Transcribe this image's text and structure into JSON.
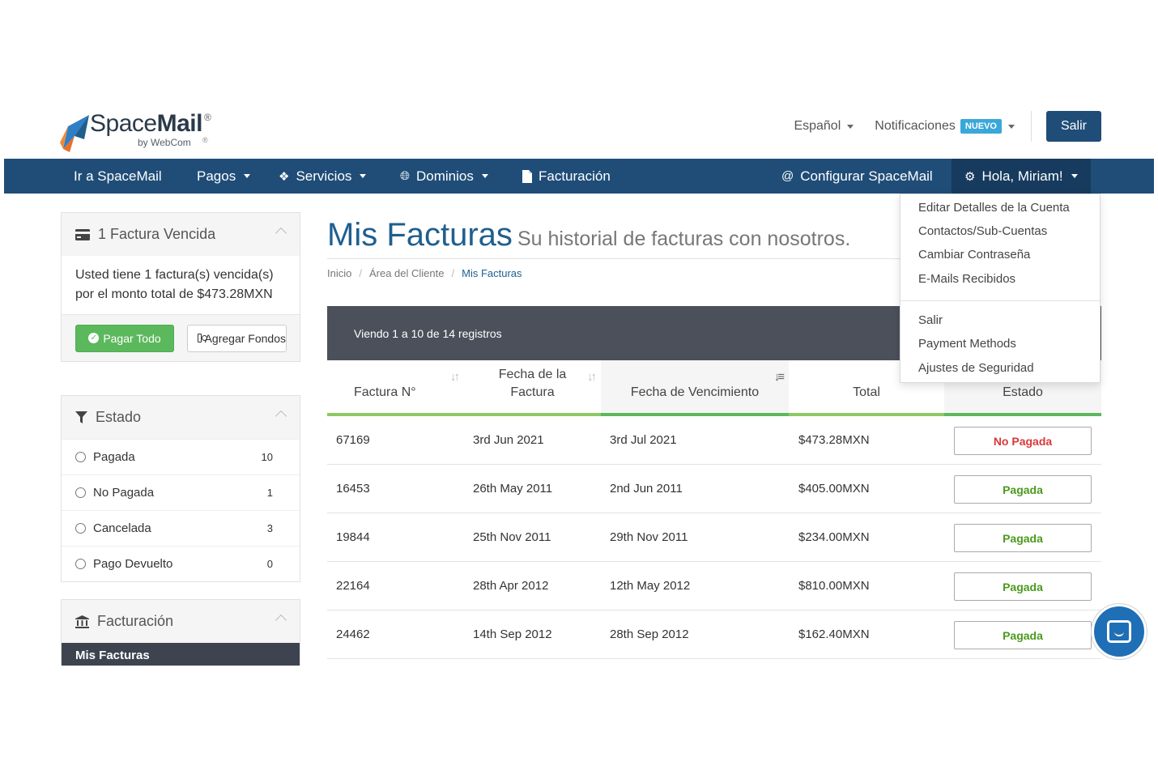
{
  "brand": {
    "logo_main": "SpaceMail",
    "logo_sub": "by WebCom",
    "logo_icon": "rocket-logo-icon",
    "colors": {
      "primary": "#1f4d78",
      "accent": "#3aa7d9",
      "success": "#5cb85c",
      "danger": "#d9383a"
    }
  },
  "topbar": {
    "language": "Español",
    "notifications": "Notificaciones",
    "new_badge": "NUEVO",
    "logout_button": "Salir"
  },
  "nav": {
    "items": [
      {
        "label": "Ir a SpaceMail"
      },
      {
        "label": "Pagos"
      },
      {
        "label": "Servicios",
        "icon": "cubes-icon"
      },
      {
        "label": "Dominios",
        "icon": "globe-icon"
      },
      {
        "label": "Facturación",
        "icon": "file-icon"
      },
      {
        "label": "Configurar SpaceMail",
        "icon": "at-icon"
      },
      {
        "label": "Hola, Miriam!",
        "icon": "gears-icon"
      }
    ]
  },
  "account_menu": {
    "items": [
      "Editar Detalles de la Cuenta",
      "Contactos/Sub-Cuentas",
      "Cambiar Contraseña",
      "E-Mails Recibidos",
      "Salir",
      "Payment Methods",
      "Ajustes de Seguridad"
    ]
  },
  "sidebar": {
    "overdue": {
      "title": "1 Factura Vencida",
      "message": "Usted tiene 1 factura(s) vencida(s) por el monto total de $473.28MXN",
      "pay_all": "Pagar Todo",
      "add_funds": "Agregar Fondos"
    },
    "status": {
      "title": "Estado",
      "items": [
        {
          "label": "Pagada",
          "count": "10"
        },
        {
          "label": "No Pagada",
          "count": "1"
        },
        {
          "label": "Cancelada",
          "count": "3"
        },
        {
          "label": "Pago Devuelto",
          "count": "0"
        }
      ]
    },
    "billing": {
      "title": "Facturación",
      "active_item": "Mis Facturas"
    }
  },
  "main": {
    "title": "Mis Facturas",
    "subtitle": "Su historial de facturas con nosotros.",
    "breadcrumb": [
      "Inicio",
      "Área del Cliente",
      "Mis Facturas"
    ],
    "table_info": "Viendo 1 a 10 de 14 registros",
    "columns": [
      "Factura N°",
      "Fecha de la Factura",
      "Fecha de Vencimiento",
      "Total",
      "Estado"
    ],
    "rows": [
      {
        "number": "67169",
        "date": "3rd Jun 2021",
        "due": "3rd Jul 2021",
        "total": "$473.28MXN",
        "status": "No Pagada",
        "state": "unpaid"
      },
      {
        "number": "16453",
        "date": "26th May 2011",
        "due": "2nd Jun 2011",
        "total": "$405.00MXN",
        "status": "Pagada",
        "state": "paid"
      },
      {
        "number": "19844",
        "date": "25th Nov 2011",
        "due": "29th Nov 2011",
        "total": "$234.00MXN",
        "status": "Pagada",
        "state": "paid"
      },
      {
        "number": "22164",
        "date": "28th Apr 2012",
        "due": "12th May 2012",
        "total": "$810.00MXN",
        "status": "Pagada",
        "state": "paid"
      },
      {
        "number": "24462",
        "date": "14th Sep 2012",
        "due": "28th Sep 2012",
        "total": "$162.40MXN",
        "status": "Pagada",
        "state": "paid"
      }
    ]
  },
  "chat_widget": {
    "icon": "chat-icon"
  }
}
